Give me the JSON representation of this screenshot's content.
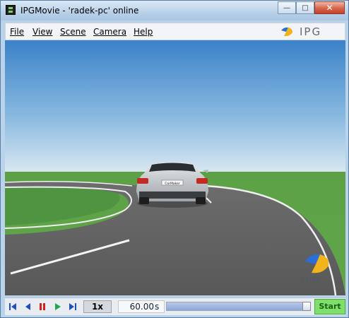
{
  "window": {
    "title": "IPGMovie - 'radek-pc' online"
  },
  "caption": {
    "minimize": "—",
    "maximize": "□",
    "close": "✕"
  },
  "menu": [
    {
      "label": "File"
    },
    {
      "label": "View"
    },
    {
      "label": "Scene"
    },
    {
      "label": "Camera"
    },
    {
      "label": "Help"
    }
  ],
  "logo": {
    "text": "IPG"
  },
  "scene": {
    "license_plate": "CarMaker",
    "corner_logo_text": "IPG"
  },
  "controls": {
    "speed": "1x",
    "time_value": "60.00",
    "time_unit": "s",
    "progress": 0.97,
    "start_label": "Start"
  },
  "icons": {
    "skip_start": "skip-start-icon",
    "step_back": "step-back-icon",
    "pause": "pause-icon",
    "play": "play-icon",
    "skip_end": "skip-end-icon"
  },
  "colors": {
    "nav_blue": "#1f4fbf",
    "pause_red": "#d02020",
    "play_green": "#21a84a",
    "start_green": "#7ee06b"
  }
}
